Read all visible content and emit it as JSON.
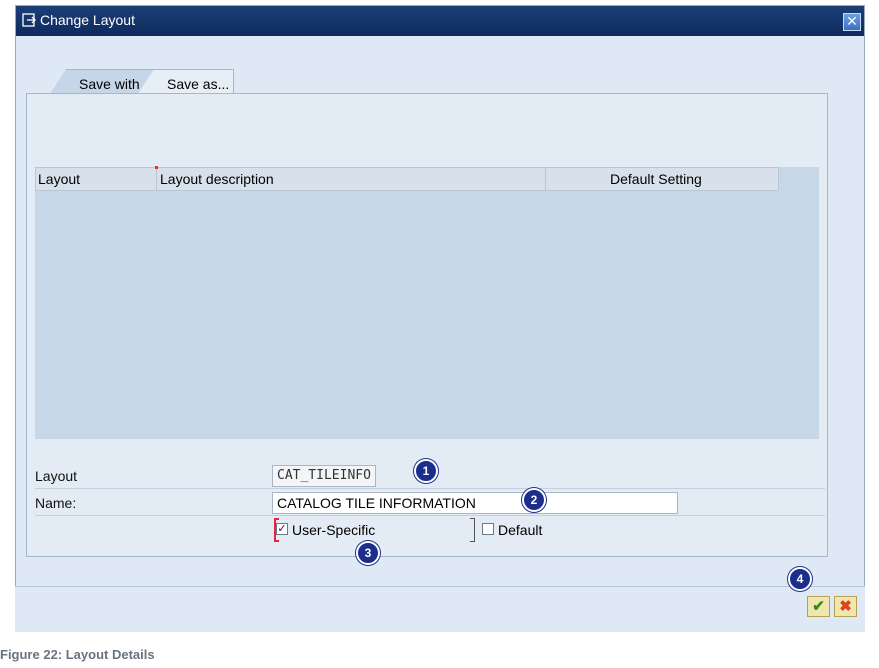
{
  "window": {
    "title": "Change Layout",
    "close_glyph": "✕"
  },
  "tabs": [
    {
      "label": "Save with"
    },
    {
      "label": "Save as..."
    }
  ],
  "table": {
    "columns": [
      "Layout",
      "Layout description",
      "Default Setting"
    ]
  },
  "form": {
    "layout_label": "Layout",
    "layout_value": "CAT_TILEINFO",
    "name_label": "Name:",
    "name_value": "CATALOG TILE INFORMATION",
    "user_specific_label": "User-Specific",
    "user_specific_checked": true,
    "default_label": "Default",
    "default_checked": false
  },
  "badges": [
    "1",
    "2",
    "3",
    "4"
  ],
  "buttons": {
    "ok_glyph": "✔",
    "cancel_glyph": "✖"
  },
  "caption": "Figure 22: Layout Details",
  "colors": {
    "title_bar": "#0d2a5c",
    "badge": "#1b2e8c",
    "ok": "#3a8b1a",
    "cancel": "#d3461f"
  },
  "icons": {
    "title": "change-layout-icon",
    "close": "close-icon",
    "ok": "checkmark-icon",
    "cancel": "cancel-icon"
  }
}
